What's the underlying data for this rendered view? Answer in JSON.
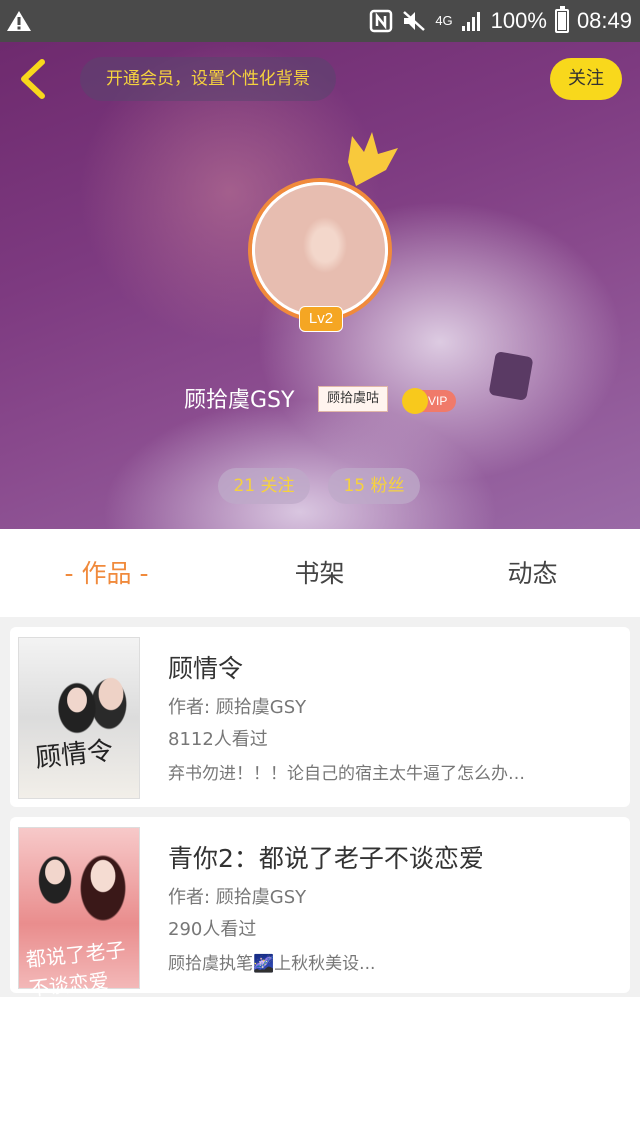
{
  "status_bar": {
    "battery": "100%",
    "time": "08:49",
    "network": "4G"
  },
  "header": {
    "vip_banner": "开通会员，设置个性化背景",
    "follow_button": "关注",
    "level_badge": "Lv2",
    "username": "顾拾虞GSY",
    "name_tag": "顾拾虞咕",
    "vip_label": "VIP",
    "stats": {
      "following": "21 关注",
      "fans": "15 粉丝"
    }
  },
  "tabs": [
    {
      "label": "- 作品 -"
    },
    {
      "label": "书架"
    },
    {
      "label": "动态"
    }
  ],
  "books": [
    {
      "title": "顾情令",
      "author": "作者: 顾拾虞GSY",
      "reads": "8112人看过",
      "description": "弃书勿进！！！论自己的宿主太牛逼了怎么办…",
      "cover_title": "顾情令"
    },
    {
      "title": "青你2：都说了老子不谈恋爱",
      "author": "作者: 顾拾虞GSY",
      "reads": "290人看过",
      "description": "顾拾虞执笔🌌上秋秋美设...",
      "cover_title": "都说了老子不谈恋爱"
    }
  ],
  "colors": {
    "accent_orange": "#f08a3c",
    "follow_yellow": "#f8d81c",
    "banner_text_yellow": "#f6d23e"
  },
  "icons": [
    "warning-icon",
    "nfc-icon",
    "mute-icon",
    "signal-icon",
    "battery-icon",
    "back-arrow-icon",
    "crown-icon",
    "vip-crown-icon"
  ]
}
